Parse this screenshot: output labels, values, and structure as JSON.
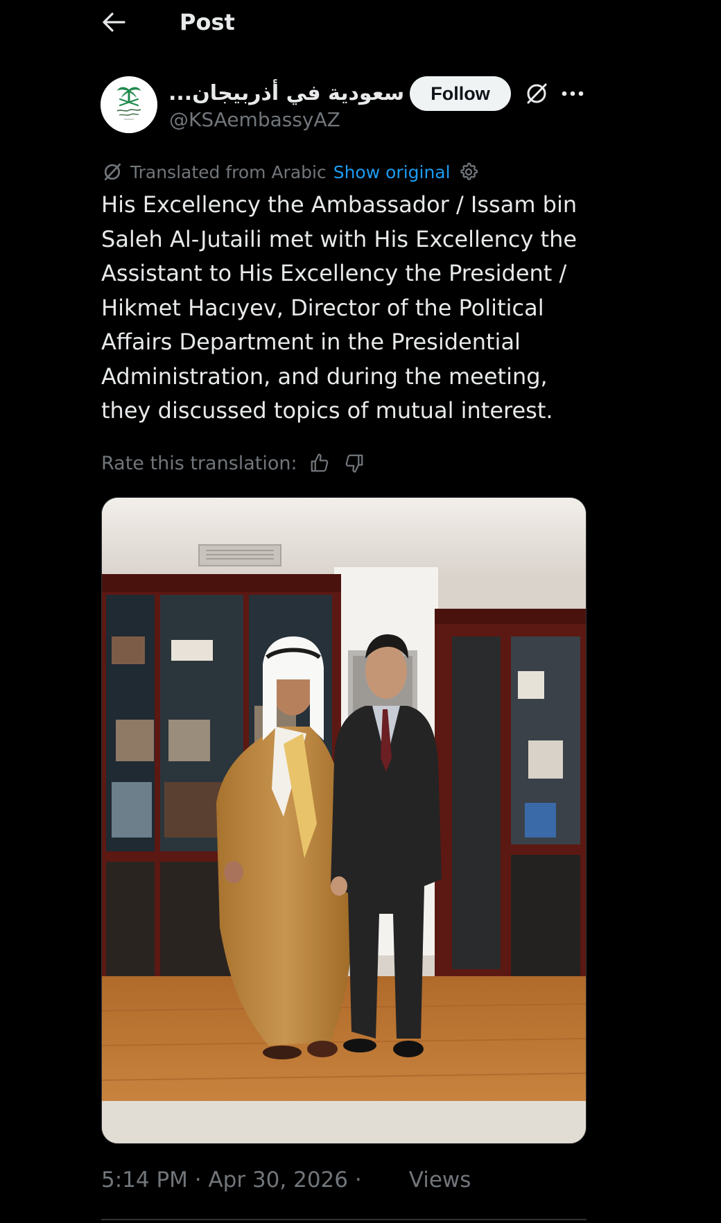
{
  "header": {
    "title": "Post",
    "back_icon": "arrow-left-icon"
  },
  "author": {
    "display_name": "...سعودية في أذربيجان",
    "handle": "@KSAembassyAZ",
    "verified_icon": "verified-badge-icon",
    "avatar_icon": "saudi-emblem-logo",
    "follow_label": "Follow",
    "grok_icon": "grok-icon",
    "more_icon": "more-horizontal-icon"
  },
  "translation": {
    "icon": "grok-icon",
    "translated_from": "Translated from Arabic",
    "show_original": "Show original",
    "settings_icon": "gear-icon"
  },
  "post": {
    "text": "His Excellency the Ambassador / Issam bin Saleh Al-Jutaili met with His Excellency the Assistant to His Excellency the President / Hikmet Hacıyev, Director of the Political Affairs Department in the Presidential Administration, and during the meeting, they discussed topics of mutual interest."
  },
  "rate": {
    "label": "Rate this translation:",
    "thumbs_up_icon": "thumbs-up-icon",
    "thumbs_down_icon": "thumbs-down-icon"
  },
  "meta": {
    "time": "5:14 PM · Apr 30, 2026 ·",
    "views_label": "Views"
  },
  "colors": {
    "background": "#000000",
    "text": "#e7e9ea",
    "secondary": "#71767b",
    "link": "#1d9bf0",
    "verified": "#829aab",
    "follow_bg": "#eff3f4"
  }
}
